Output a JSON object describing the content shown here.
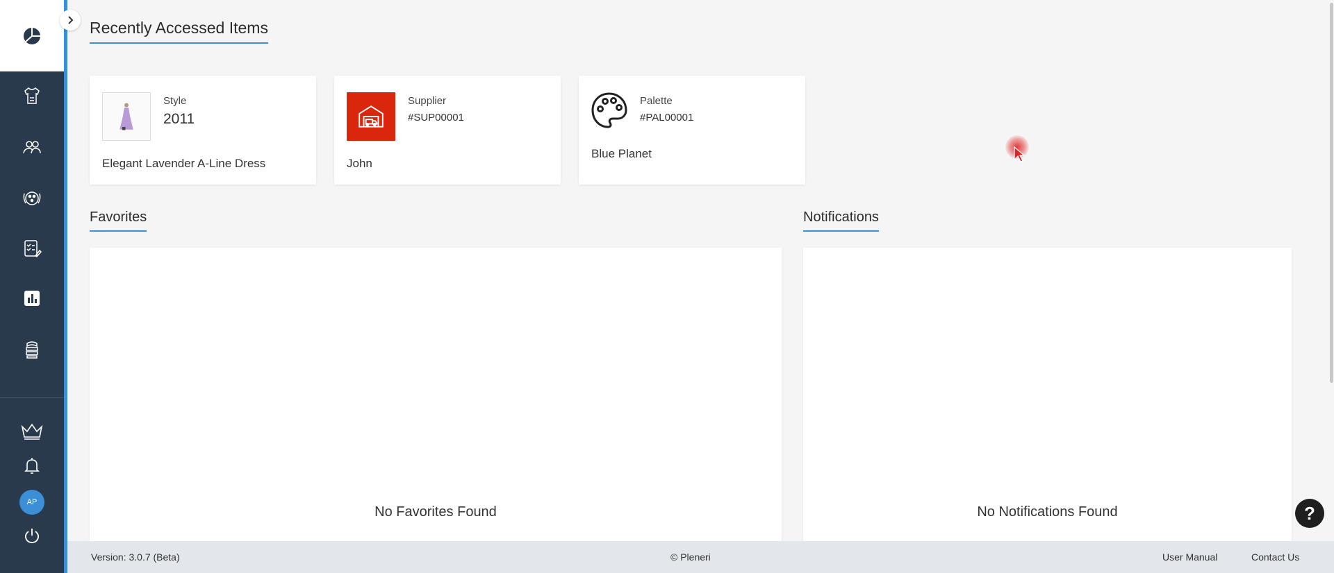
{
  "sidebar": {
    "items": [
      {
        "icon": "pie-chart-icon"
      },
      {
        "icon": "apparel-icon"
      },
      {
        "icon": "users-icon"
      },
      {
        "icon": "palette-flow-icon"
      },
      {
        "icon": "checklist-icon"
      },
      {
        "icon": "bar-chart-icon"
      },
      {
        "icon": "stack-icon"
      }
    ],
    "bottom_items": [
      {
        "icon": "crown-icon"
      },
      {
        "icon": "bell-icon"
      },
      {
        "icon": "power-icon"
      }
    ],
    "avatar_initials": "AP"
  },
  "recent": {
    "title": "Recently Accessed Items",
    "cards": [
      {
        "type": "Style",
        "code": "2011",
        "name": "Elegant Lavender A-Line Dress"
      },
      {
        "type": "Supplier",
        "code": "#SUP00001",
        "name": "John"
      },
      {
        "type": "Palette",
        "code": "#PAL00001",
        "name": "Blue Planet"
      }
    ]
  },
  "favorites": {
    "title": "Favorites",
    "empty_text": "No Favorites Found"
  },
  "notifications": {
    "title": "Notifications",
    "empty_text": "No Notifications Found"
  },
  "footer": {
    "version": "Version: 3.0.7 (Beta)",
    "copyright": "© Pleneri",
    "user_manual": "User Manual",
    "contact_us": "Contact Us"
  },
  "help": {
    "label": "?"
  },
  "colors": {
    "sidebar_bg": "#293a4c",
    "accent": "#3a8fd6",
    "supplier_red": "#d9260c",
    "page_bg": "#f5f5f6"
  }
}
